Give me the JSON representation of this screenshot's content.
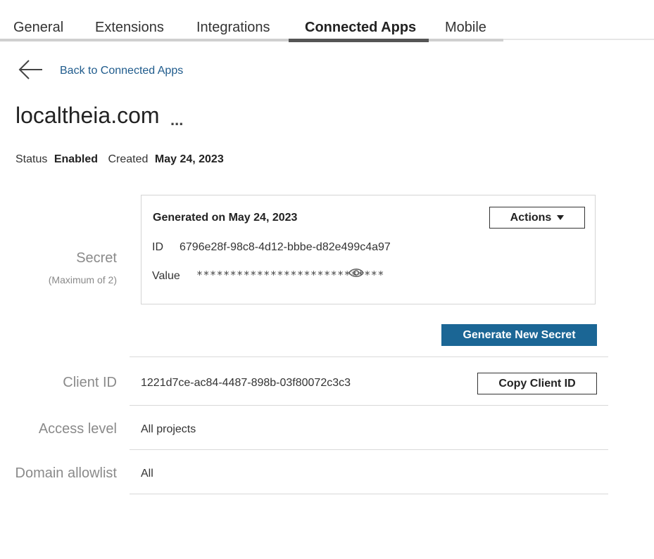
{
  "tabs": [
    {
      "label": "General",
      "active": false
    },
    {
      "label": "Extensions",
      "active": false
    },
    {
      "label": "Integrations",
      "active": false
    },
    {
      "label": "Connected Apps",
      "active": true
    },
    {
      "label": "Mobile",
      "active": false
    }
  ],
  "back": {
    "label": "Back to Connected Apps"
  },
  "app": {
    "title": "localtheia.com",
    "more": "...",
    "status_label": "Status",
    "status_value": "Enabled",
    "created_label": "Created",
    "created_value": "May 24, 2023"
  },
  "secret": {
    "label": "Secret",
    "sublabel": "(Maximum of 2)",
    "generated": "Generated on May 24, 2023",
    "actions_label": "Actions",
    "id_label": "ID",
    "id_value": "6796e28f-98c8-4d12-bbbe-d82e499c4a97",
    "value_label": "Value",
    "value_masked": "****************************",
    "generate_label": "Generate New Secret"
  },
  "client": {
    "label": "Client ID",
    "value": "1221d7ce-ac84-4487-898b-03f80072c3c3",
    "copy_label": "Copy Client ID"
  },
  "access": {
    "label": "Access level",
    "value": "All projects"
  },
  "domain": {
    "label": "Domain allowlist",
    "value": "All"
  },
  "colors": {
    "primary_button": "#1b6695",
    "link": "#1f5b8c",
    "muted_label": "#8a8a8a"
  }
}
